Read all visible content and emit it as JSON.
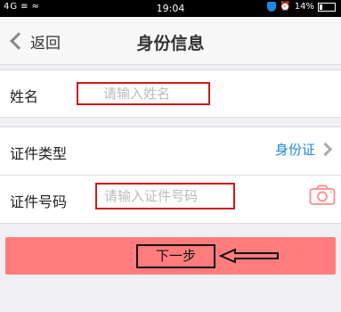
{
  "status_bar": {
    "signal_left": "4G ≡ ≈",
    "time": "19:04",
    "battery_percent": "14%"
  },
  "nav": {
    "back_label": "返回",
    "title": "身份信息"
  },
  "name_row": {
    "label": "姓名",
    "placeholder": "请输入姓名"
  },
  "id_type_row": {
    "label": "证件类型",
    "value": "身份证"
  },
  "id_number_row": {
    "label": "证件号码",
    "placeholder": "请输入证件号码"
  },
  "next_button": {
    "label": "下一步"
  },
  "colors": {
    "accent_blue": "#1e88d8",
    "button_bg": "#ff7c7c",
    "annotation_red": "#d0181b",
    "camera": "#ff8a8a"
  },
  "icons": {
    "back": "chevron-left-icon",
    "id_type": "chevron-right-icon",
    "scan": "camera-icon",
    "annotation": "arrow-left-icon"
  }
}
